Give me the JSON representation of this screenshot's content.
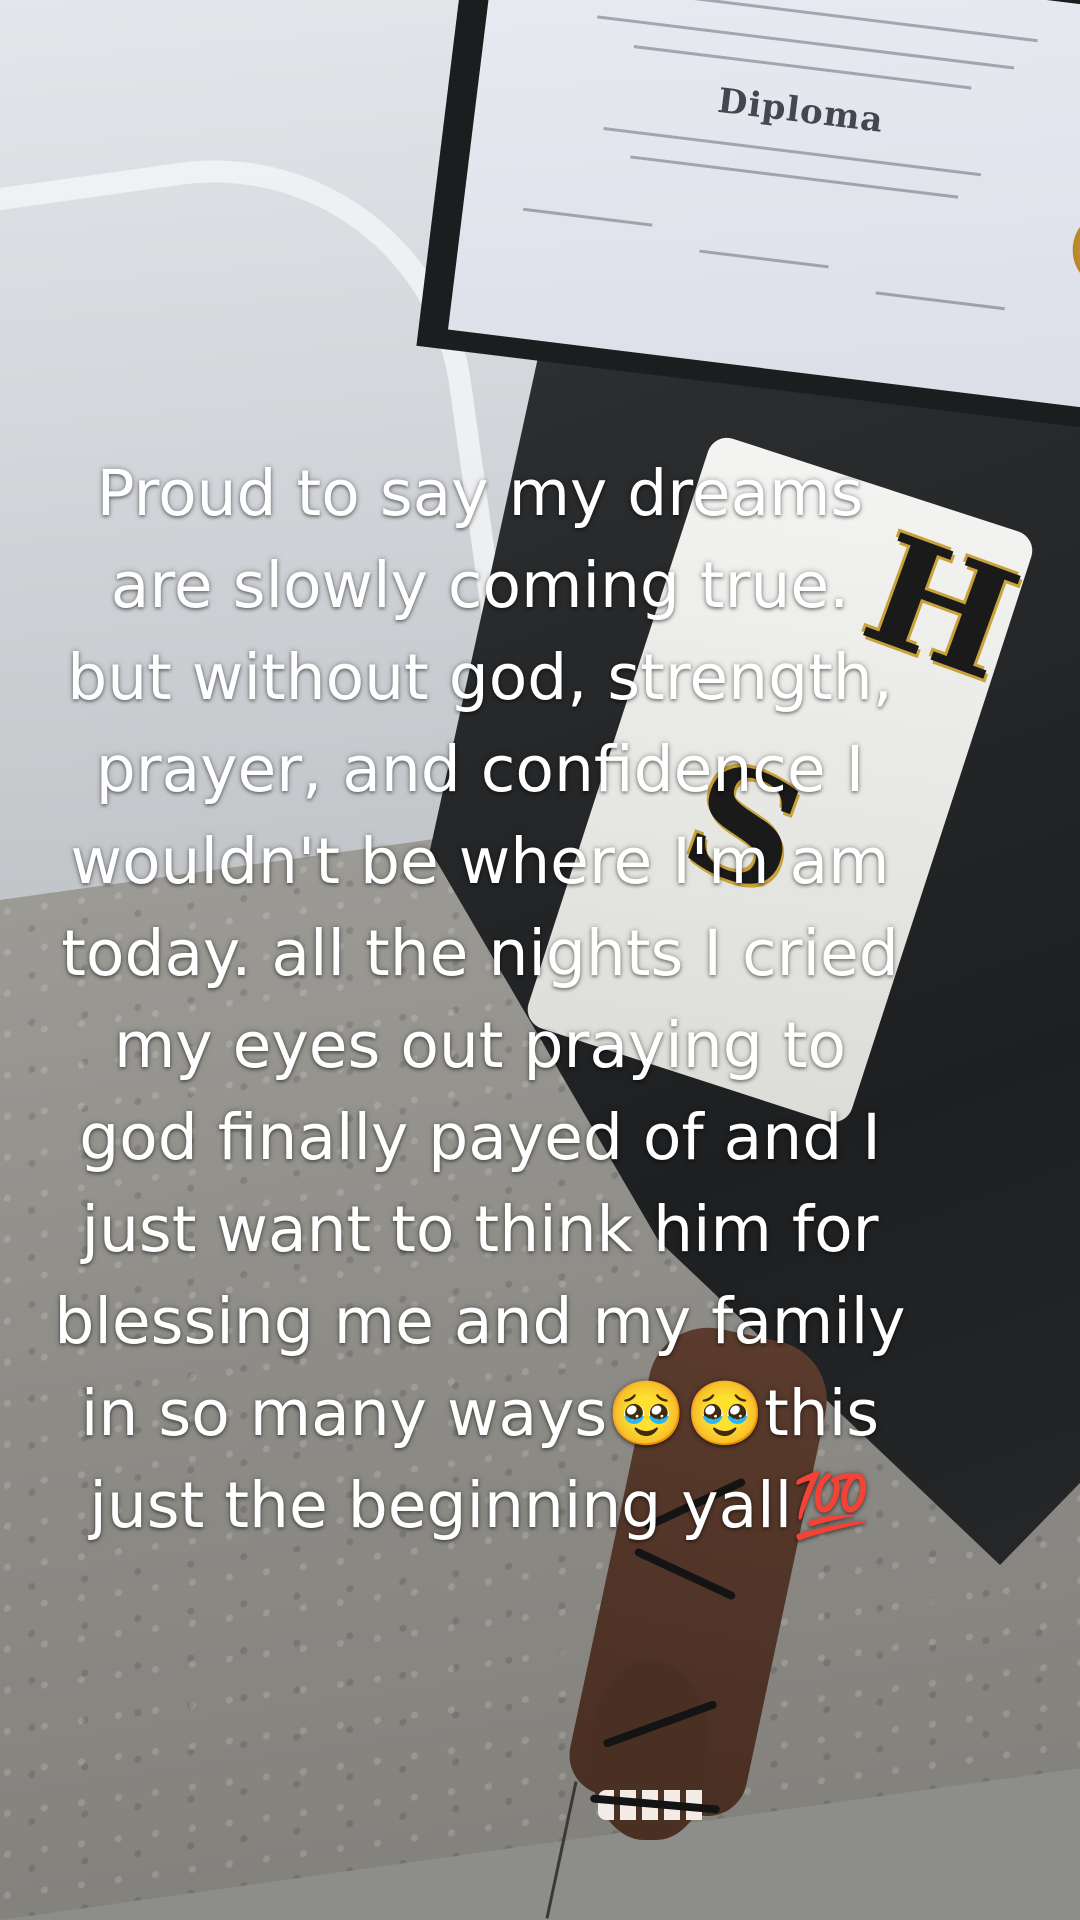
{
  "caption": {
    "lines": [
      "Proud to say my dreams",
      "are slowly coming true.",
      "but without god, strength,",
      "prayer, and confidence I",
      "wouldn't be where I'm am",
      "today. all the nights I cried",
      "my eyes out praying to",
      "god finally payed of and I",
      "just want to think him for",
      "blessing me and my family",
      "in so many ways🥹🥹this",
      "just the beginning yall💯"
    ]
  },
  "diploma": {
    "title": "Diploma"
  },
  "colors": {
    "caption_text": "#ffffff",
    "gown": "#1d1f21",
    "stole": "#f4f4f2",
    "stole_trim": "#c9a23a"
  }
}
